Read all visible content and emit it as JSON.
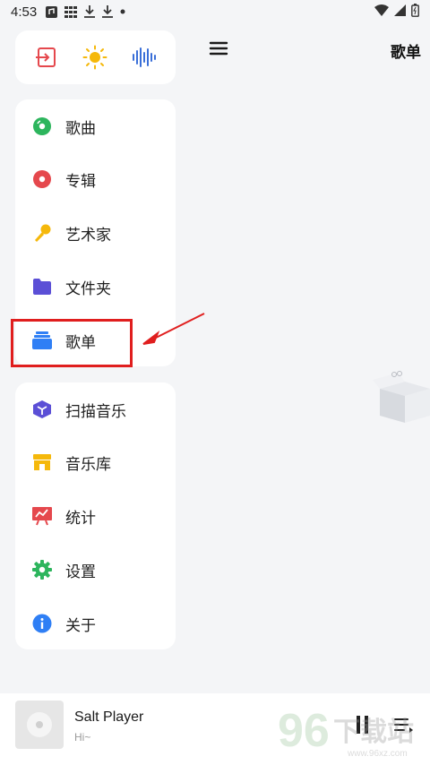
{
  "status_bar": {
    "time": "4:53",
    "left_icons": [
      "notification-icon",
      "grid-icon",
      "download-icon",
      "download-icon",
      "dot-icon"
    ],
    "right_icons": [
      "wifi-icon",
      "signal-icon",
      "battery-icon"
    ]
  },
  "quick_actions": [
    {
      "name": "exit-icon",
      "color": "#e5484d"
    },
    {
      "name": "sun-icon",
      "color": "#f5b80b"
    },
    {
      "name": "waveform-icon",
      "color": "#3a6fd8"
    }
  ],
  "library_nav": {
    "items": [
      {
        "label": "歌曲",
        "icon": "song-disc-icon",
        "color": "#2db55d"
      },
      {
        "label": "专辑",
        "icon": "album-disc-icon",
        "color": "#e5484d"
      },
      {
        "label": "艺术家",
        "icon": "microphone-icon",
        "color": "#f5b80b"
      },
      {
        "label": "文件夹",
        "icon": "folder-icon",
        "color": "#5b4fd6"
      },
      {
        "label": "歌单",
        "icon": "playlist-icon",
        "color": "#2f7ff5"
      }
    ]
  },
  "tools_nav": {
    "items": [
      {
        "label": "扫描音乐",
        "icon": "scan-cube-icon",
        "color": "#5b4fd6"
      },
      {
        "label": "音乐库",
        "icon": "store-icon",
        "color": "#f5b80b"
      },
      {
        "label": "统计",
        "icon": "chart-board-icon",
        "color": "#e5484d"
      },
      {
        "label": "设置",
        "icon": "gear-icon",
        "color": "#2db55d"
      },
      {
        "label": "关于",
        "icon": "info-icon",
        "color": "#2f7ff5"
      }
    ]
  },
  "header": {
    "title": "歌单"
  },
  "player": {
    "title": "Salt Player",
    "subtitle": "Hi~"
  },
  "watermark": {
    "number": "96",
    "text": "下载站",
    "url": "www.96xz.com"
  },
  "colors": {
    "annotation": "#e01e1e",
    "background": "#f4f5f7",
    "card": "#ffffff"
  }
}
